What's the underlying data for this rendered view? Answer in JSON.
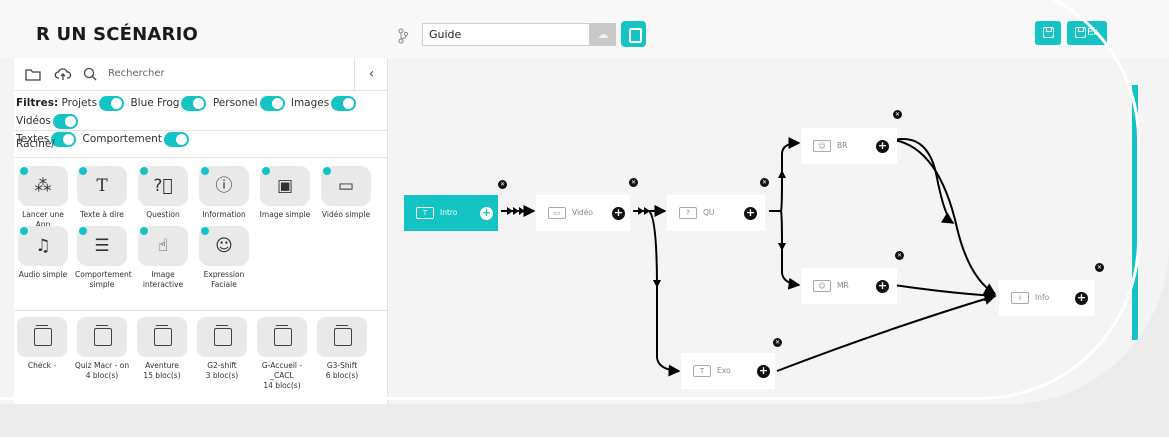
{
  "header": {
    "title": "R UN SCÉNARIO",
    "project_input": "Guide"
  },
  "sidebar": {
    "search_placeholder": "Rechercher",
    "filters_label": "Filtres:",
    "filters": [
      "Projets",
      "Blue Frog",
      "Personel",
      "Images",
      "Vidéos",
      "Textes",
      "Comportement"
    ],
    "breadcrumb": "Racine/",
    "blocks": [
      {
        "label": "Lancer une App",
        "icon": "apps-icon"
      },
      {
        "label": "Texte à dire",
        "icon": "text-icon"
      },
      {
        "label": "Question",
        "icon": "question-icon"
      },
      {
        "label": "Information",
        "icon": "info-icon"
      },
      {
        "label": "Image simple",
        "icon": "image-icon"
      },
      {
        "label": "Vidéo simple",
        "icon": "video-icon"
      },
      {
        "label": "Audio simple",
        "icon": "music-icon"
      },
      {
        "label": "Comportement simple",
        "icon": "sliders-icon"
      },
      {
        "label": "Image interactive",
        "icon": "hand-pointer-icon"
      },
      {
        "label": "Expression Faciale",
        "icon": "smiley-icon"
      }
    ],
    "projects": [
      {
        "name": "Check -",
        "count": ""
      },
      {
        "name": "Quiz Macr - on",
        "count": "4 bloc(s)"
      },
      {
        "name": "Aventure",
        "count": "15 bloc(s)"
      },
      {
        "name": "G2-shift",
        "count": "3 bloc(s)"
      },
      {
        "name": "G-Accueil - _CACL",
        "count": "14 bloc(s)"
      },
      {
        "name": "G3-Shift",
        "count": "6 bloc(s)"
      }
    ]
  },
  "graph": {
    "nodes": [
      {
        "id": "intro",
        "label": "Intro",
        "icon": "T"
      },
      {
        "id": "video",
        "label": "Vidéo",
        "icon": "▭"
      },
      {
        "id": "qu",
        "label": "QU",
        "icon": "?"
      },
      {
        "id": "br",
        "label": "BR",
        "icon": "☺"
      },
      {
        "id": "mr",
        "label": "MR",
        "icon": "☺"
      },
      {
        "id": "exo",
        "label": "Exo",
        "icon": "T"
      },
      {
        "id": "info",
        "label": "Info",
        "icon": "i"
      }
    ]
  },
  "colors": {
    "accent": "#14c3c3",
    "bg": "#f4f4f4"
  }
}
